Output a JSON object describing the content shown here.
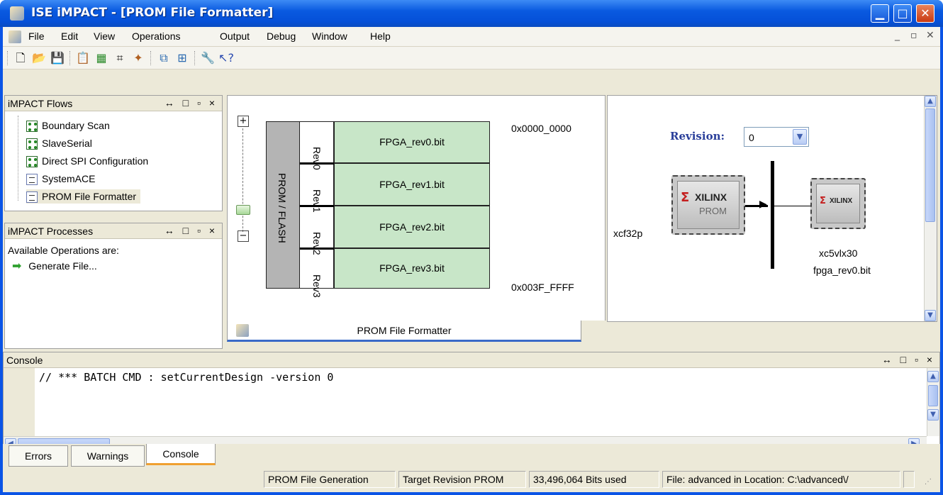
{
  "window": {
    "title": "ISE iMPACT - [PROM File Formatter]"
  },
  "menu": {
    "items": [
      {
        "label": "File"
      },
      {
        "label": "Edit"
      },
      {
        "label": "View"
      },
      {
        "label": "Operations"
      },
      {
        "label": "Output"
      },
      {
        "label": "Debug"
      },
      {
        "label": "Window"
      },
      {
        "label": "Help"
      }
    ]
  },
  "flows_panel": {
    "title": "iMPACT Flows",
    "controls": "↔ □ ▫ ×",
    "items": [
      {
        "label": "Boundary Scan",
        "icon": "grid-icon"
      },
      {
        "label": "SlaveSerial",
        "icon": "grid-icon"
      },
      {
        "label": "Direct SPI Configuration",
        "icon": "grid-icon"
      },
      {
        "label": "SystemACE",
        "icon": "doc-icon"
      },
      {
        "label": "PROM File Formatter",
        "icon": "doc-icon"
      }
    ]
  },
  "processes_panel": {
    "title": "iMPACT Processes",
    "controls": "↔ □ ▫ ×",
    "header_text": "Available Operations are:",
    "operation": "Generate File..."
  },
  "prom_view": {
    "memory_label": "PROM / FLASH",
    "revisions": [
      "Rev0",
      "Rev1",
      "Rev2",
      "Rev3"
    ],
    "files": [
      "FPGA_rev0.bit",
      "FPGA_rev1.bit",
      "FPGA_rev2.bit",
      "FPGA_rev3.bit"
    ],
    "start_address": "0x0000_0000",
    "end_address": "0x003F_FFFF",
    "tab_label": "PROM File Formatter"
  },
  "device_view": {
    "revision_label": "Revision:",
    "revision_value": "0",
    "prom_device": "xcf32p",
    "prom_chip_brand": "XILINX",
    "prom_chip_type": "PROM",
    "fpga_chip_brand": "XILINX",
    "fpga_device": "xc5vlx30",
    "fpga_file": "fpga_rev0.bit"
  },
  "console": {
    "title": "Console",
    "controls": "↔ □ ▫ ×",
    "line": "// *** BATCH CMD : setCurrentDesign -version 0"
  },
  "bottom_tabs": [
    {
      "label": "Errors"
    },
    {
      "label": "Warnings"
    },
    {
      "label": "Console"
    }
  ],
  "status_bar": {
    "process": "PROM File Generation",
    "target": "Target Revision PROM",
    "bits": "33,496,064 Bits used",
    "file": "File: advanced in Location: C:\\advanced\\/"
  },
  "colors": {
    "titlebar": "#0a54e6",
    "cell_fill": "#c8e6c8",
    "prom_column": "#b4b4b4",
    "revision_label": "#2a3f9a",
    "active_tab_accent": "#f0a030"
  }
}
